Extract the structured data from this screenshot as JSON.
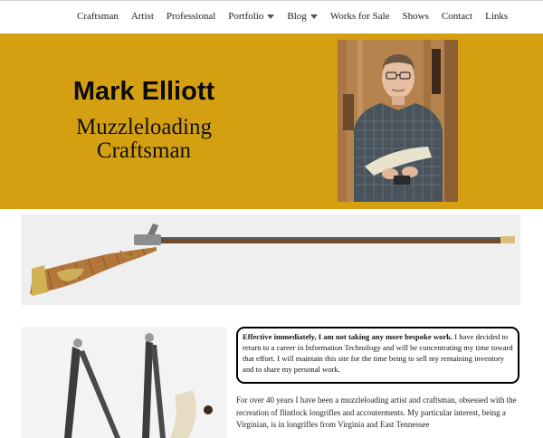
{
  "nav": {
    "items": [
      {
        "label": "Craftsman"
      },
      {
        "label": "Artist"
      },
      {
        "label": "Professional"
      },
      {
        "label": "Portfolio",
        "dropdown": true
      },
      {
        "label": "Blog",
        "dropdown": true
      },
      {
        "label": "Works for Sale"
      },
      {
        "label": "Shows"
      },
      {
        "label": "Contact"
      },
      {
        "label": "Links"
      }
    ]
  },
  "header": {
    "name": "Mark Elliott",
    "subtitle_line1": "Muzzleloading",
    "subtitle_line2": "Craftsman"
  },
  "notice": {
    "bold": "Effective immediately, I am not taking any more bespoke work.",
    "text": " I have decided to return to a career in Information Technology and will be concentrating my time toward that effort.   I will maintain this site for the time being to sell my remaining inventory and to share my personal work."
  },
  "intro": {
    "text": "For over 40 years I have been a muzzleloading artist and craftsman, obsessed with the recreation of flintlock longrifles and accouterments. My particular interest, being a Virginian, is in longrifles from Virginia and East Tennessee"
  },
  "colors": {
    "hero_bg": "#d4a012",
    "nav_bg": "#ffffff"
  }
}
